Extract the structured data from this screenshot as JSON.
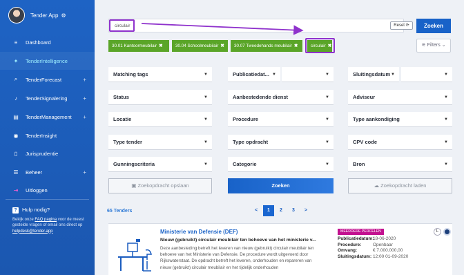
{
  "sidebar": {
    "app_title": "Tender App",
    "items": [
      {
        "label": "Dashboard",
        "icon": "dashboard-icon",
        "glyph": "≡"
      },
      {
        "label": "TenderIntelligence",
        "icon": "lightbulb-icon",
        "glyph": "✦"
      },
      {
        "label": "TenderForecast",
        "icon": "search-icon",
        "glyph": "⌕",
        "plus": "+"
      },
      {
        "label": "TenderSignalering",
        "icon": "bell-icon",
        "glyph": "♪",
        "plus": "+"
      },
      {
        "label": "TenderManagement",
        "icon": "table-icon",
        "glyph": "▤",
        "plus": "+"
      },
      {
        "label": "TenderInsight",
        "icon": "eye-icon",
        "glyph": "◉"
      },
      {
        "label": "Jurisprudentie",
        "icon": "document-icon",
        "glyph": "▯"
      },
      {
        "label": "Beheer",
        "icon": "sliders-icon",
        "glyph": "☰",
        "plus": "+"
      },
      {
        "label": "Uitloggen",
        "icon": "logout-icon",
        "glyph": "⇥"
      }
    ],
    "help": {
      "title": "Hulp nodig?",
      "text_before": "Bekijk onze ",
      "faq_link": "FAQ pagina",
      "text_middle": " voor de meest gestelde vragen of email ons direct op ",
      "email": "helpdesk@tender.app"
    }
  },
  "search": {
    "value": "circulair",
    "reset_label": "Reset",
    "submit_label": "Zoeken"
  },
  "tags": [
    {
      "label": "30.01 Kantoormeubilair"
    },
    {
      "label": "30.04 Schoolmeubilair"
    },
    {
      "label": "30.07 Tweedehands meubilair"
    },
    {
      "label": "circulair"
    }
  ],
  "filters_label": "Filters",
  "filter_fields": {
    "matching_tags": "Matching tags",
    "publicatiedatum": "Publicatiedat...",
    "sluitingsdatum": "Sluitingsdatum",
    "status": "Status",
    "aanbestedende_dienst": "Aanbestedende dienst",
    "adviseur": "Adviseur",
    "locatie": "Locatie",
    "procedure": "Procedure",
    "type_aankondiging": "Type aankondiging",
    "type_tender": "Type tender",
    "type_opdracht": "Type opdracht",
    "cpv_code": "CPV code",
    "gunningscriteria": "Gunningscriteria",
    "categorie": "Categorie",
    "bron": "Bron"
  },
  "actions": {
    "save_label": "Zoekopdracht opslaan",
    "search_label": "Zoeken",
    "load_label": "Zoekopdracht laden"
  },
  "results": {
    "count_label": "65 Tenders",
    "pages": [
      "<",
      "1",
      "2",
      "3",
      ">"
    ],
    "active_page": "1"
  },
  "tender": {
    "organization": "Ministerie van Defensie (DEF)",
    "title": "Nieuw (gebruikt) circulair meubilair ten behoeve van het ministerie v...",
    "description": "Deze aanbesteding betreft het leveren van nieuw (gebruikt) circulair meubilair ten behoeve van het Ministerie van Defensie. De procedure wordt uitgevoerd door Rijkswaterstaat. De opdracht betreft het leveren, onderhouden en repareren van nieuw (gebruikt) circulair meubilair en het tijdelijk onderhouden",
    "badge": "MEERDERE PERCELEN",
    "meta": [
      {
        "key": "Publicatiedatum:",
        "value": "18-06-2020"
      },
      {
        "key": "Procedure:",
        "value": "Openbaar"
      },
      {
        "key": "Omvang:",
        "value": "€ 7.000.000,00"
      },
      {
        "key": "Sluitingsdatum:",
        "value": "12:00 01-09-2020"
      }
    ],
    "letter_badge": "L"
  },
  "colors": {
    "sidebar": "#1e63c4",
    "primary": "#1862c8",
    "tag": "#5aa528",
    "highlight": "#8f32cc",
    "badge": "#c2118f"
  }
}
